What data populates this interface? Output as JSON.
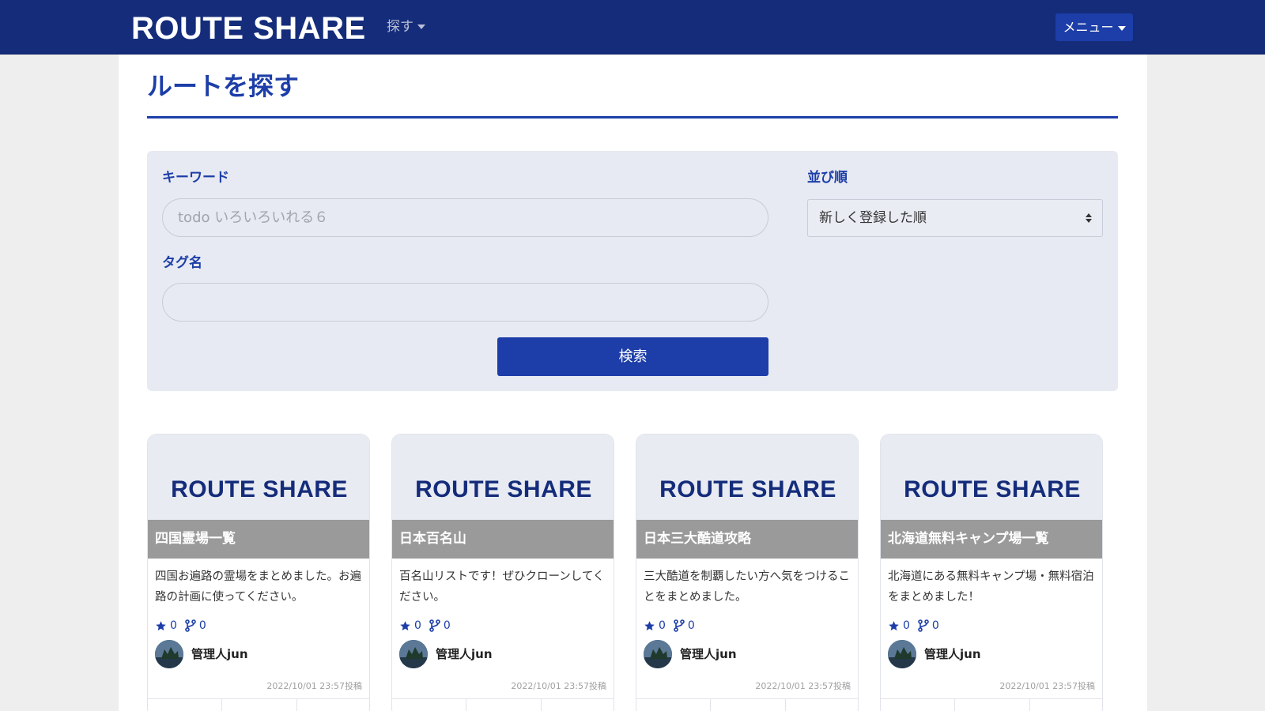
{
  "navbar": {
    "brand": "ROUTE SHARE",
    "find_label": "探す",
    "menu_label": "メニュー"
  },
  "page": {
    "title": "ルートを探す"
  },
  "search": {
    "keyword_label": "キーワード",
    "keyword_placeholder": "todo いろいろいれる６",
    "tag_label": "タグ名",
    "tag_value": "",
    "sort_label": "並び順",
    "sort_value": "新しく登録した順",
    "submit_label": "検索"
  },
  "colors": {
    "navbar": "#142c7a",
    "accent": "#1d3ea8",
    "search_bg": "#e7eaf2",
    "card_title_bar": "#9a9a9a"
  },
  "cards": [
    {
      "logo": "ROUTE SHARE",
      "title": "四国霊場一覧",
      "description": "四国お遍路の霊場をまとめました。お遍路の計画に使ってください。",
      "stars": "0",
      "forks": "0",
      "author": "管理人jun",
      "date": "2022/10/01 23:57投稿"
    },
    {
      "logo": "ROUTE SHARE",
      "title": "日本百名山",
      "description": "百名山リストです！ぜひクローンしてください。",
      "stars": "0",
      "forks": "0",
      "author": "管理人jun",
      "date": "2022/10/01 23:57投稿"
    },
    {
      "logo": "ROUTE SHARE",
      "title": "日本三大酷道攻略",
      "description": "三大酷道を制覇したい方へ気をつけることをまとめました。",
      "stars": "0",
      "forks": "0",
      "author": "管理人jun",
      "date": "2022/10/01 23:57投稿"
    },
    {
      "logo": "ROUTE SHARE",
      "title": "北海道無料キャンプ場一覧",
      "description": "北海道にある無料キャンプ場・無料宿泊をまとめました！",
      "stars": "0",
      "forks": "0",
      "author": "管理人jun",
      "date": "2022/10/01 23:57投稿"
    }
  ]
}
